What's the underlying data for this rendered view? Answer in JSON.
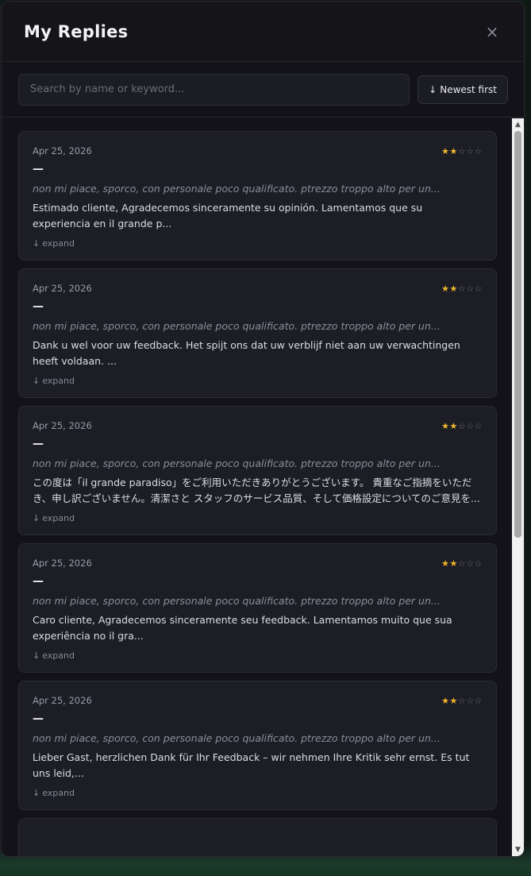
{
  "header": {
    "title": "My Replies",
    "close_label": "×"
  },
  "toolbar": {
    "search_placeholder": "Search by name or keyword...",
    "sort_label": "Newest first",
    "sort_icon": "↓"
  },
  "replies": [
    {
      "date": "Apr 25, 2026",
      "rating": 2,
      "name": "—",
      "review": "non mi piace, sporco, con personale poco qualificato. ptrezzo troppo alto per un...",
      "reply": "Estimado cliente, Agradecemos sinceramente su opinión. Lamentamos que su experiencia en il grande p...",
      "expand_label": "expand"
    },
    {
      "date": "Apr 25, 2026",
      "rating": 2,
      "name": "—",
      "review": "non mi piace, sporco, con personale poco qualificato. ptrezzo troppo alto per un...",
      "reply": "Dank u wel voor uw feedback. Het spijt ons dat uw verblijf niet aan uw verwachtingen heeft voldaan. ...",
      "expand_label": "expand"
    },
    {
      "date": "Apr 25, 2026",
      "rating": 2,
      "name": "—",
      "review": "non mi piace, sporco, con personale poco qualificato. ptrezzo troppo alto per un...",
      "reply": "この度は「il grande paradiso」をご利用いただきありがとうございます。 貴重なご指摘をいただき、申し訳ございません。清潔さと スタッフのサービス品質、そして価格設定についてのご意見を...",
      "expand_label": "expand"
    },
    {
      "date": "Apr 25, 2026",
      "rating": 2,
      "name": "—",
      "review": "non mi piace, sporco, con personale poco qualificato. ptrezzo troppo alto per un...",
      "reply": "Caro cliente, Agradecemos sinceramente seu feedback. Lamentamos muito que sua experiência no il gra...",
      "expand_label": "expand"
    },
    {
      "date": "Apr 25, 2026",
      "rating": 2,
      "name": "—",
      "review": "non mi piace, sporco, con personale poco qualificato. ptrezzo troppo alto per un...",
      "reply": "Lieber Gast, herzlichen Dank für Ihr Feedback – wir nehmen Ihre Kritik sehr ernst. Es tut uns leid,...",
      "expand_label": "expand"
    },
    {
      "date": "",
      "rating": 0,
      "name": "",
      "review": "",
      "reply": "",
      "expand_label": ""
    }
  ],
  "colors": {
    "star_on": "#f3b72a",
    "star_off": "#6b6b76",
    "accent_glow": "#1b3a2a"
  },
  "scrollbar": {
    "position_fraction": 0.0,
    "visible_fraction": 0.55
  }
}
